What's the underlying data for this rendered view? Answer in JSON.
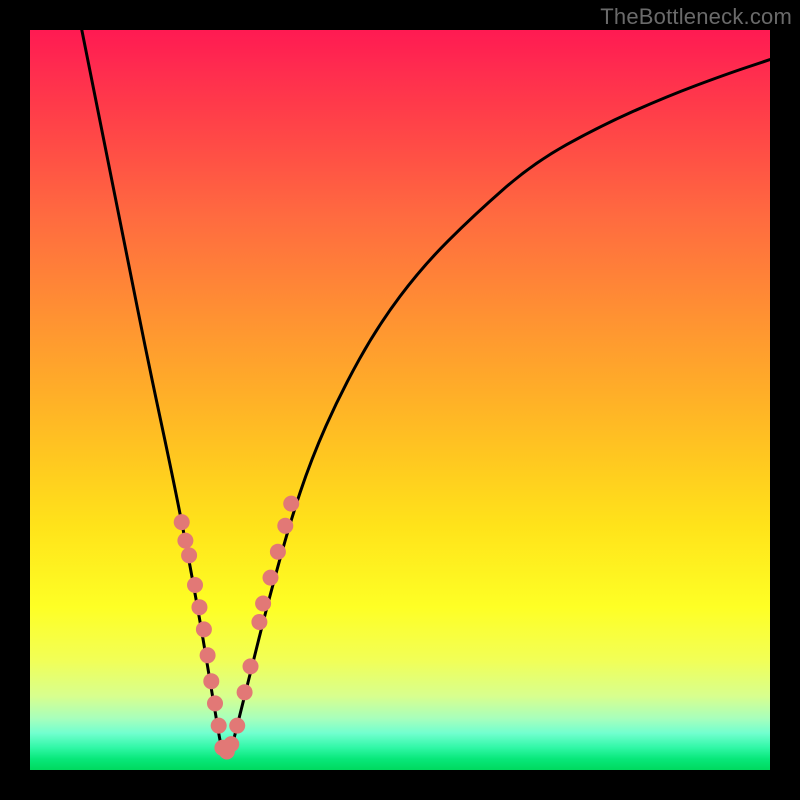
{
  "watermark": "TheBottleneck.com",
  "chart_data": {
    "type": "line",
    "title": "",
    "xlabel": "",
    "ylabel": "",
    "xlim": [
      0,
      100
    ],
    "ylim": [
      0,
      100
    ],
    "grid": false,
    "legend": "none",
    "note": "V-shaped bottleneck curve with minimum near x≈26; colored background gradient encodes y (red high, green low); salmon marker dots cluster around the minimum.",
    "series": [
      {
        "name": "bottleneck-curve",
        "type": "line",
        "x": [
          7,
          10,
          13,
          16,
          19,
          21,
          23,
          24,
          25,
          26,
          27,
          28,
          30,
          32,
          35,
          38,
          42,
          47,
          53,
          60,
          68,
          77,
          86,
          94,
          100
        ],
        "y": [
          100,
          85,
          70,
          55,
          41,
          31,
          20,
          14,
          8,
          2,
          2,
          6,
          14,
          22,
          33,
          42,
          51,
          60,
          68,
          75,
          82,
          87,
          91,
          94,
          96
        ]
      },
      {
        "name": "marker-dots",
        "type": "scatter",
        "x": [
          20.5,
          21.0,
          21.5,
          22.3,
          22.9,
          23.5,
          24.0,
          24.5,
          25.0,
          25.5,
          26.0,
          26.6,
          27.2,
          28.0,
          29.0,
          29.8,
          31.0,
          31.5,
          32.5,
          33.5,
          34.5,
          35.3
        ],
        "y": [
          33.5,
          31.0,
          29.0,
          25.0,
          22.0,
          19.0,
          15.5,
          12.0,
          9.0,
          6.0,
          3.0,
          2.5,
          3.5,
          6.0,
          10.5,
          14.0,
          20.0,
          22.5,
          26.0,
          29.5,
          33.0,
          36.0
        ]
      }
    ],
    "colors": {
      "curve": "#000000",
      "dots": "#e27876",
      "gradient_top": "#ff1a52",
      "gradient_mid": "#ffe31a",
      "gradient_bottom": "#00d95e"
    }
  }
}
